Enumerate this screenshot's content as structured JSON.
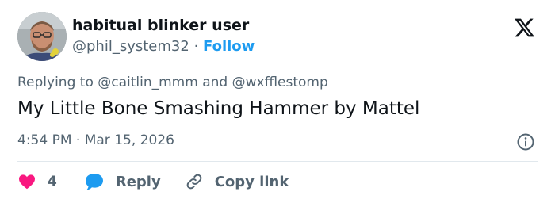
{
  "author": {
    "display_name": "habitual blinker user",
    "handle": "@phil_system32",
    "separator": "·",
    "follow_label": "Follow"
  },
  "tweet": {
    "replying_to_prefix": "Replying to",
    "replying_to_1": "@caitlin_mmm",
    "replying_to_and": "and",
    "replying_to_2": "@wxfflestomp",
    "text": "My Little Bone Smashing Hammer by Mattel",
    "time": "4:54 PM",
    "time_separator": "·",
    "date": "Mar 15, 2026"
  },
  "actions": {
    "like_count": "4",
    "reply_label": "Reply",
    "copy_link_label": "Copy link"
  },
  "icons": {
    "platform_logo": "x-logo-icon",
    "info": "info-icon",
    "like": "heart-icon",
    "reply": "chat-bubble-icon",
    "copy_link": "link-icon"
  },
  "colors": {
    "like": "#f91880",
    "reply": "#1d9bf0",
    "follow": "#1d9bf0",
    "secondary_text": "#536471"
  }
}
